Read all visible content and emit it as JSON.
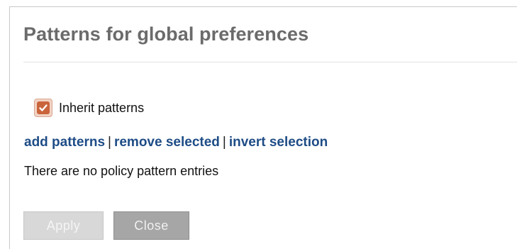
{
  "dialog": {
    "title": "Patterns for global preferences",
    "inherit": {
      "label": "Inherit patterns",
      "checked": true
    },
    "actions": {
      "add_label": "add patterns",
      "remove_label": "remove selected",
      "invert_label": "invert selection",
      "separator": "|"
    },
    "empty_message": "There are no policy pattern entries",
    "buttons": {
      "apply_label": "Apply",
      "apply_enabled": false,
      "close_label": "Close"
    }
  },
  "colors": {
    "title": "#6b6b6b",
    "link": "#1e4c86",
    "checkbox_accent": "#c9643b",
    "close_button": "#a6a6a6",
    "apply_button_disabled": "#d8d8d8"
  },
  "icons": {
    "checkbox": "checkmark-icon"
  }
}
